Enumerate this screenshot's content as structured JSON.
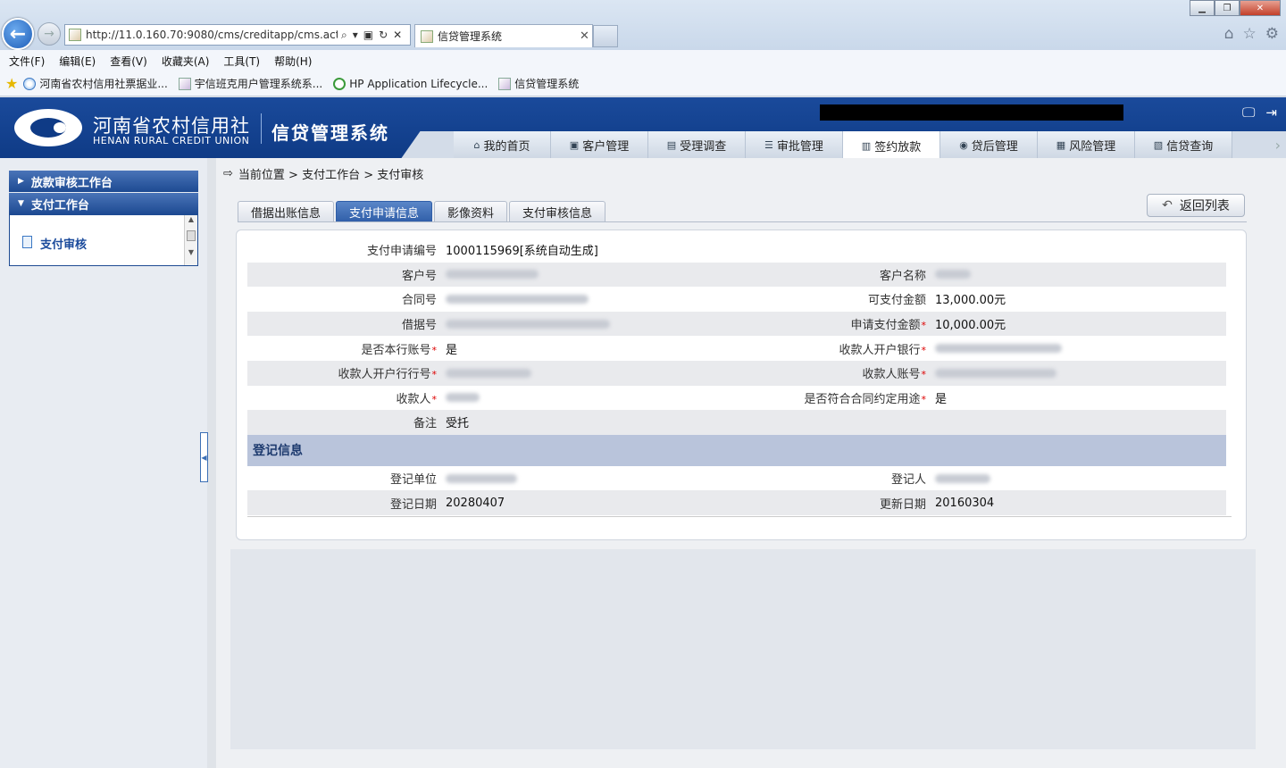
{
  "browser": {
    "url": "http://11.0.160.70:9080/cms/creditapp/cms.actic",
    "tab_title": "信贷管理系统",
    "menu": [
      "文件(F)",
      "编辑(E)",
      "查看(V)",
      "收藏夹(A)",
      "工具(T)",
      "帮助(H)"
    ],
    "favorites": [
      "河南省农村信用社票据业...",
      "宇信班克用户管理系统系...",
      "HP Application Lifecycle...",
      "信贷管理系统"
    ]
  },
  "header": {
    "logo_cn": "河南省农村信用社",
    "logo_en": "HENAN RURAL CREDIT UNION",
    "system_title": "信贷管理系统",
    "nav": [
      "我的首页",
      "客户管理",
      "受理调查",
      "审批管理",
      "签约放款",
      "贷后管理",
      "风险管理",
      "信贷查询"
    ],
    "active_nav": "签约放款"
  },
  "sidebar": {
    "groups": [
      "放款审核工作台",
      "支付工作台"
    ],
    "item": "支付审核"
  },
  "main": {
    "breadcrumb": "当前位置 > 支付工作台 > 支付审核",
    "tabs": [
      "借据出账信息",
      "支付申请信息",
      "影像资料",
      "支付审核信息"
    ],
    "active_tab": "支付申请信息",
    "return_label": "返回列表",
    "form": {
      "pay_no_label": "支付申请编号",
      "pay_no_value": "1000115969[系统自动生成]",
      "cust_no_label": "客户号",
      "cust_name_label": "客户名称",
      "contract_label": "合同号",
      "payable_label": "可支付金额",
      "payable_value": "13,000.00元",
      "loan_no_label": "借据号",
      "apply_amt_label": "申请支付金额",
      "apply_amt_value": "10,000.00元",
      "own_bank_label": "是否本行账号",
      "own_bank_value": "是",
      "payee_bank_label": "收款人开户银行",
      "payee_bank_no_label": "收款人开户行行号",
      "payee_acct_label": "收款人账号",
      "payee_label": "收款人",
      "purpose_label": "是否符合合同约定用途",
      "purpose_value": "是",
      "remark_label": "备注",
      "remark_value": "受托",
      "section_title": "登记信息",
      "reg_unit_label": "登记单位",
      "reg_user_label": "登记人",
      "reg_date_label": "登记日期",
      "reg_date_value": "20280407",
      "upd_date_label": "更新日期",
      "upd_date_value": "20160304"
    }
  }
}
